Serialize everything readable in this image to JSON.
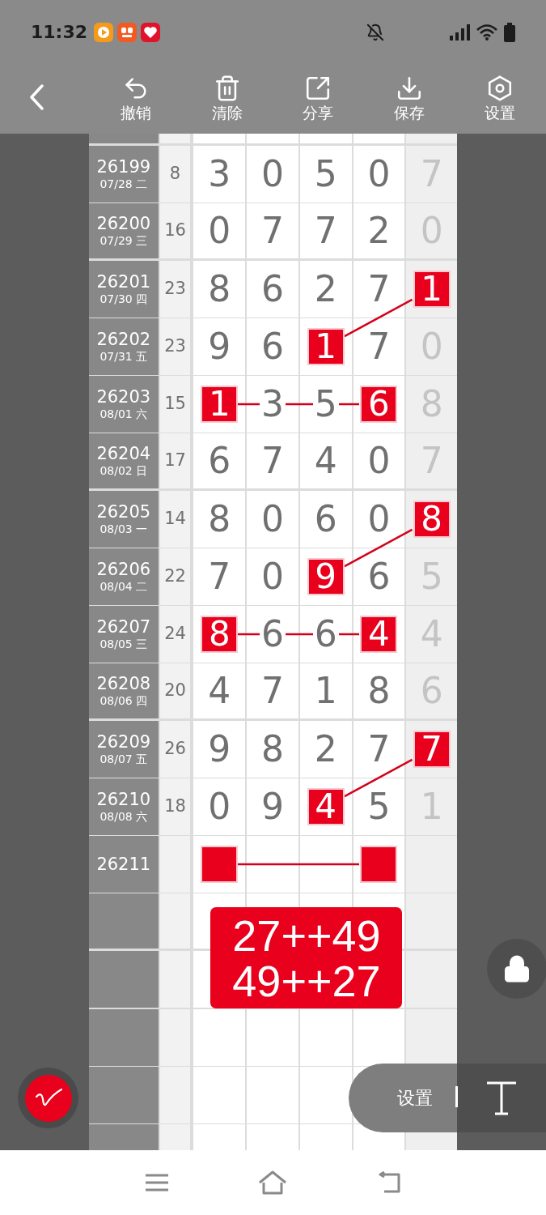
{
  "status_bar": {
    "time": "11:32"
  },
  "toolbar": {
    "items": [
      {
        "kind": "undo",
        "label": "撤销"
      },
      {
        "kind": "clear",
        "label": "清除"
      },
      {
        "kind": "share",
        "label": "分享"
      },
      {
        "kind": "save",
        "label": "保存"
      },
      {
        "kind": "settings",
        "label": "设置"
      }
    ]
  },
  "table": {
    "rows": [
      {
        "issue": "26199",
        "date": "07/28 二",
        "sum": "8",
        "cells": [
          {
            "value": "3",
            "marked": false
          },
          {
            "value": "0",
            "marked": false
          },
          {
            "value": "5",
            "marked": false
          },
          {
            "value": "0",
            "marked": false
          },
          {
            "value": "7",
            "marked": false
          }
        ]
      },
      {
        "issue": "26200",
        "date": "07/29 三",
        "sum": "16",
        "cells": [
          {
            "value": "0",
            "marked": false
          },
          {
            "value": "7",
            "marked": false
          },
          {
            "value": "7",
            "marked": false
          },
          {
            "value": "2",
            "marked": false
          },
          {
            "value": "0",
            "marked": false
          }
        ]
      },
      {
        "issue": "26201",
        "date": "07/30 四",
        "sum": "23",
        "cells": [
          {
            "value": "8",
            "marked": false
          },
          {
            "value": "6",
            "marked": false
          },
          {
            "value": "2",
            "marked": false
          },
          {
            "value": "7",
            "marked": false
          },
          {
            "value": "1",
            "marked": true
          }
        ]
      },
      {
        "issue": "26202",
        "date": "07/31 五",
        "sum": "23",
        "cells": [
          {
            "value": "9",
            "marked": false
          },
          {
            "value": "6",
            "marked": false
          },
          {
            "value": "1",
            "marked": true
          },
          {
            "value": "7",
            "marked": false
          },
          {
            "value": "0",
            "marked": false
          }
        ]
      },
      {
        "issue": "26203",
        "date": "08/01 六",
        "sum": "15",
        "cells": [
          {
            "value": "1",
            "marked": true
          },
          {
            "value": "3",
            "marked": false
          },
          {
            "value": "5",
            "marked": false
          },
          {
            "value": "6",
            "marked": true
          },
          {
            "value": "8",
            "marked": false
          }
        ]
      },
      {
        "issue": "26204",
        "date": "08/02 日",
        "sum": "17",
        "cells": [
          {
            "value": "6",
            "marked": false
          },
          {
            "value": "7",
            "marked": false
          },
          {
            "value": "4",
            "marked": false
          },
          {
            "value": "0",
            "marked": false
          },
          {
            "value": "7",
            "marked": false
          }
        ]
      },
      {
        "issue": "26205",
        "date": "08/03 一",
        "sum": "14",
        "cells": [
          {
            "value": "8",
            "marked": false
          },
          {
            "value": "0",
            "marked": false
          },
          {
            "value": "6",
            "marked": false
          },
          {
            "value": "0",
            "marked": false
          },
          {
            "value": "8",
            "marked": true
          }
        ]
      },
      {
        "issue": "26206",
        "date": "08/04 二",
        "sum": "22",
        "cells": [
          {
            "value": "7",
            "marked": false
          },
          {
            "value": "0",
            "marked": false
          },
          {
            "value": "9",
            "marked": true
          },
          {
            "value": "6",
            "marked": false
          },
          {
            "value": "5",
            "marked": false
          }
        ]
      },
      {
        "issue": "26207",
        "date": "08/05 三",
        "sum": "24",
        "cells": [
          {
            "value": "8",
            "marked": true
          },
          {
            "value": "6",
            "marked": false
          },
          {
            "value": "6",
            "marked": false
          },
          {
            "value": "4",
            "marked": true
          },
          {
            "value": "4",
            "marked": false
          }
        ]
      },
      {
        "issue": "26208",
        "date": "08/06 四",
        "sum": "20",
        "cells": [
          {
            "value": "4",
            "marked": false
          },
          {
            "value": "7",
            "marked": false
          },
          {
            "value": "1",
            "marked": false
          },
          {
            "value": "8",
            "marked": false
          },
          {
            "value": "6",
            "marked": false
          }
        ]
      },
      {
        "issue": "26209",
        "date": "08/07 五",
        "sum": "26",
        "cells": [
          {
            "value": "9",
            "marked": false
          },
          {
            "value": "8",
            "marked": false
          },
          {
            "value": "2",
            "marked": false
          },
          {
            "value": "7",
            "marked": false
          },
          {
            "value": "7",
            "marked": true
          }
        ]
      },
      {
        "issue": "26210",
        "date": "08/08 六",
        "sum": "18",
        "cells": [
          {
            "value": "0",
            "marked": false
          },
          {
            "value": "9",
            "marked": false
          },
          {
            "value": "4",
            "marked": true
          },
          {
            "value": "5",
            "marked": false
          },
          {
            "value": "1",
            "marked": false
          }
        ]
      },
      {
        "issue": "26211",
        "cells": [
          {
            "marked": true
          },
          {
            "marked": false
          },
          {
            "marked": false
          },
          {
            "marked": true
          },
          {
            "marked": false
          }
        ]
      }
    ]
  },
  "result_label": {
    "lines": [
      "27++49",
      "49++27"
    ]
  },
  "settings_panel": {
    "label": "设置"
  }
}
